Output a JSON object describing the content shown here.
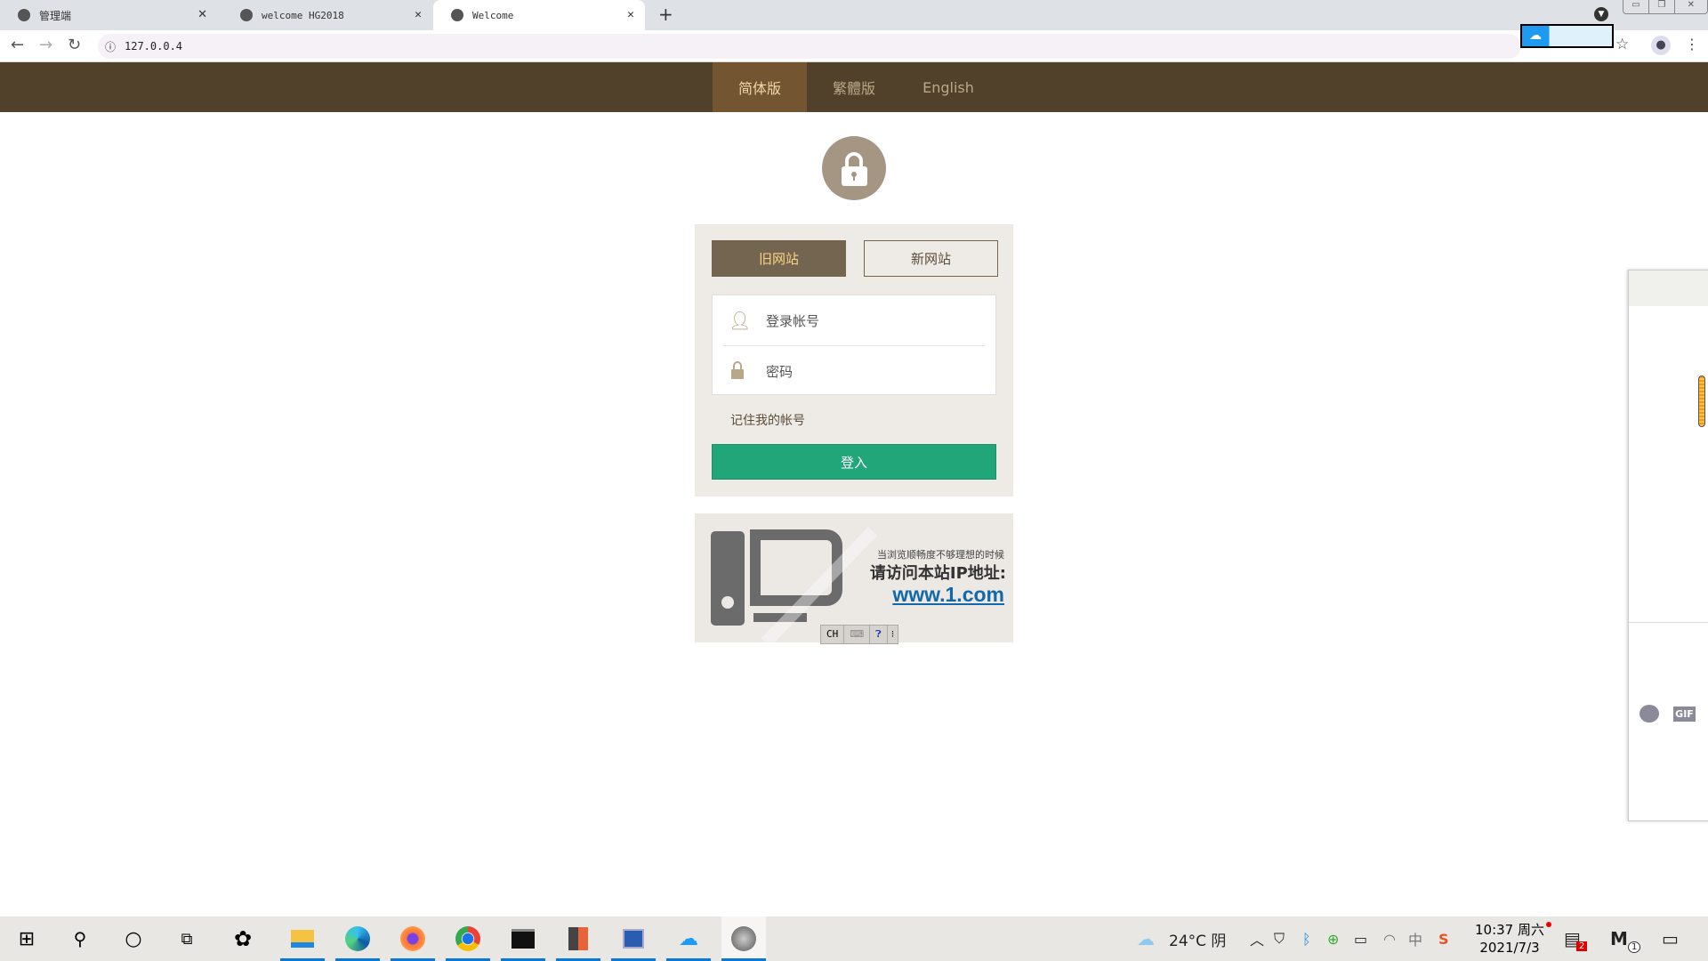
{
  "browser": {
    "tabs": [
      {
        "title": "管理端"
      },
      {
        "title": "welcome HG2018"
      },
      {
        "title": "Welcome",
        "active": true
      }
    ],
    "new_tab": "+",
    "url": "127.0.0.4"
  },
  "language_bar": {
    "items": [
      {
        "label": "简体版",
        "active": true
      },
      {
        "label": "繁體版"
      },
      {
        "label": "English"
      }
    ]
  },
  "login": {
    "site_switch": {
      "old": "旧网站",
      "new": "新网站",
      "selected": "old"
    },
    "account_placeholder": "登录帐号",
    "password_placeholder": "密码",
    "remember": "记住我的帐号",
    "submit": "登入"
  },
  "banner": {
    "line1": "当浏览顺畅度不够理想的时候",
    "line2": "请访问本站IP地址:",
    "link": "www.1.com"
  },
  "ime_toolbar": {
    "lang": "CH"
  },
  "chat_widget": {
    "gif": "GIF"
  },
  "taskbar": {
    "weather": "24°C 阴",
    "time": "10:37 周六",
    "date": "2021/7/3",
    "notif_badge": "2",
    "m_badge": "1",
    "ime": "中"
  },
  "colors": {
    "header": "#52412a",
    "active_lang": "#735532",
    "login_button": "#21a67a",
    "panel": "#eeeae5"
  }
}
